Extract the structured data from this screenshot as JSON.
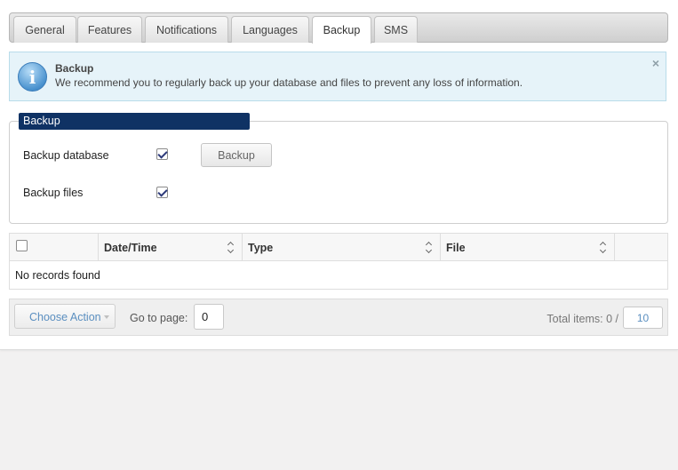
{
  "tabs": [
    {
      "label": "General",
      "active": false
    },
    {
      "label": "Features",
      "active": false
    },
    {
      "label": "Notifications",
      "active": false
    },
    {
      "label": "Languages",
      "active": false
    },
    {
      "label": "Backup",
      "active": true
    },
    {
      "label": "SMS",
      "active": false
    }
  ],
  "notice": {
    "title": "Backup",
    "text": "We recommend you to regularly back up your database and files to prevent any loss of information.",
    "icon": "info-icon",
    "close_glyph": "×"
  },
  "backup_section": {
    "legend": "Backup",
    "database_label": "Backup database",
    "database_checked": true,
    "files_label": "Backup files",
    "files_checked": true,
    "backup_button": "Backup"
  },
  "grid": {
    "columns": [
      "",
      "Date/Time",
      "Type",
      "File",
      ""
    ],
    "empty_text": "No records found"
  },
  "pager": {
    "action_label": "Choose Action",
    "goto_label": "Go to page:",
    "page_value": "0",
    "total_label": "Total items: 0 /",
    "page_size": "10"
  },
  "colors": {
    "legend_bg": "#0f3264",
    "notice_bg": "#e6f3f9",
    "link_blue": "#5b8fc0"
  }
}
